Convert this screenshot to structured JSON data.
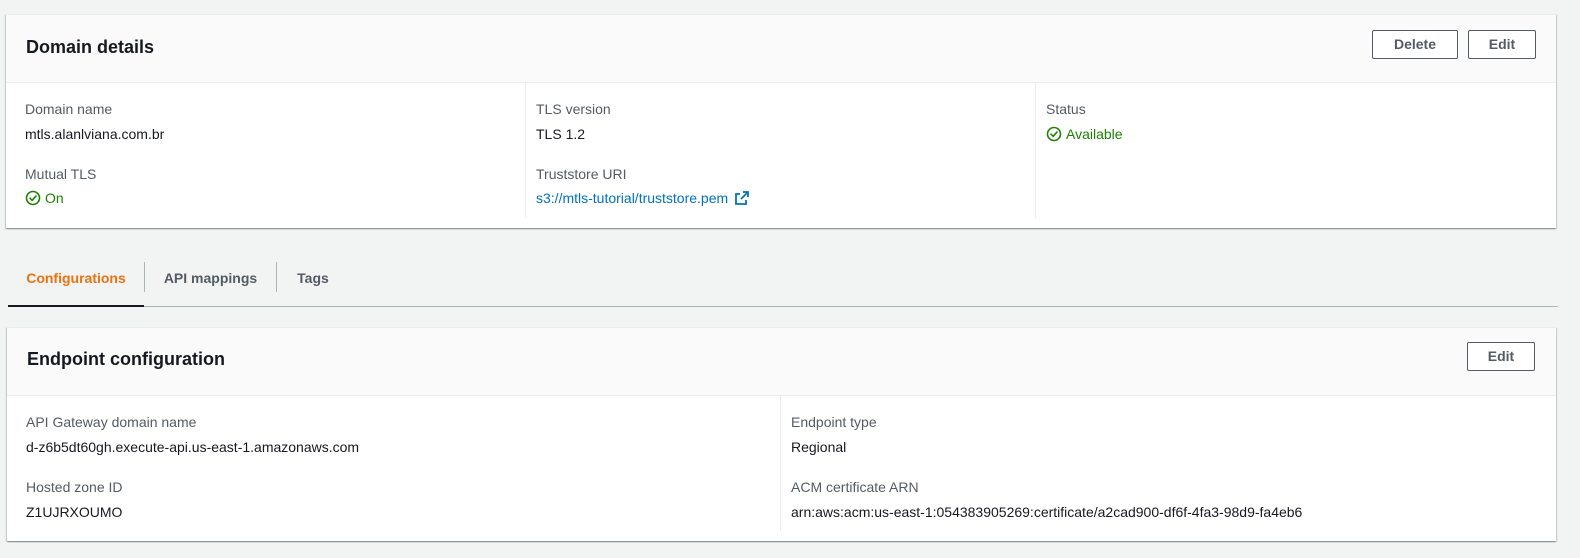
{
  "domain_details": {
    "title": "Domain details",
    "delete_label": "Delete",
    "edit_label": "Edit",
    "domain_name_label": "Domain name",
    "domain_name_value": "mtls.alanlviana.com.br",
    "mutual_tls_label": "Mutual TLS",
    "mutual_tls_value": "On",
    "tls_version_label": "TLS version",
    "tls_version_value": "TLS 1.2",
    "truststore_label": "Truststore URI",
    "truststore_value": "s3://mtls-tutorial/truststore.pem",
    "status_label": "Status",
    "status_value": "Available"
  },
  "tabs": [
    {
      "label": "Configurations",
      "active": true
    },
    {
      "label": "API mappings",
      "active": false
    },
    {
      "label": "Tags",
      "active": false
    }
  ],
  "endpoint_configuration": {
    "title": "Endpoint configuration",
    "edit_label": "Edit",
    "api_gateway_domain_label": "API Gateway domain name",
    "api_gateway_domain_value": "d-z6b5dt60gh.execute-api.us-east-1.amazonaws.com",
    "hosted_zone_label": "Hosted zone ID",
    "hosted_zone_value": "Z1UJRXOUMO",
    "endpoint_type_label": "Endpoint type",
    "endpoint_type_value": "Regional",
    "acm_arn_label": "ACM certificate ARN",
    "acm_arn_value": "arn:aws:acm:us-east-1:054383905269:certificate/a2cad900-df6f-4fa3-98d9-fa4eb6"
  },
  "colors": {
    "accent_tab": "#ec7211",
    "status_ok": "#1d8102",
    "link": "#0073bb"
  },
  "icons": {
    "status": "check-circle-icon",
    "external_link": "external-link-icon"
  }
}
